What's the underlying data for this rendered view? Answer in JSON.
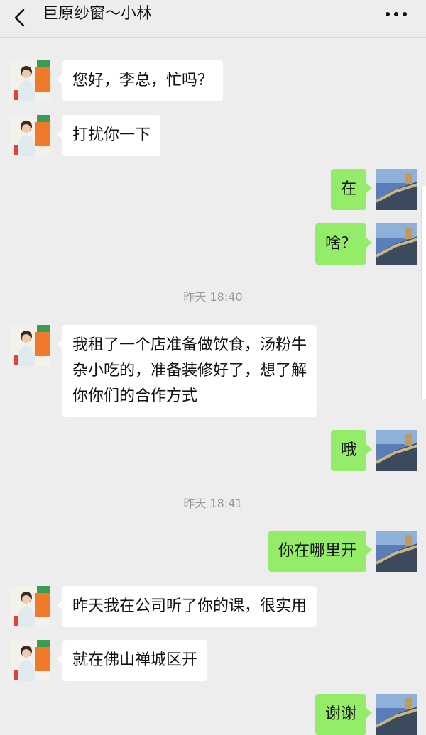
{
  "header": {
    "title": "巨原纱窗～小林",
    "back_icon": "chevron-left-icon",
    "more_icon": "more-dots-icon"
  },
  "colors": {
    "background": "#ededed",
    "incoming_bubble": "#ffffff",
    "outgoing_bubble": "#95ec69"
  },
  "messages": [
    {
      "side": "in",
      "text": "您好，李总，忙吗？"
    },
    {
      "side": "in",
      "text": "打扰你一下"
    },
    {
      "side": "out",
      "text": "在"
    },
    {
      "side": "out",
      "text": "啥？"
    },
    {
      "time": "昨天 18:40"
    },
    {
      "side": "in",
      "lines": [
        "我租了一个店准备做饮食，汤粉牛",
        "杂小吃的，准备装修好了，想了解",
        "你你们的合作方式"
      ]
    },
    {
      "side": "out",
      "text": "哦"
    },
    {
      "time": "昨天 18:41"
    },
    {
      "side": "out",
      "text": "你在哪里开"
    },
    {
      "side": "in",
      "text": "昨天我在公司听了你的课，很实用"
    },
    {
      "side": "in",
      "text": "就在佛山禅城区开"
    },
    {
      "side": "out",
      "text": "谢谢"
    }
  ]
}
